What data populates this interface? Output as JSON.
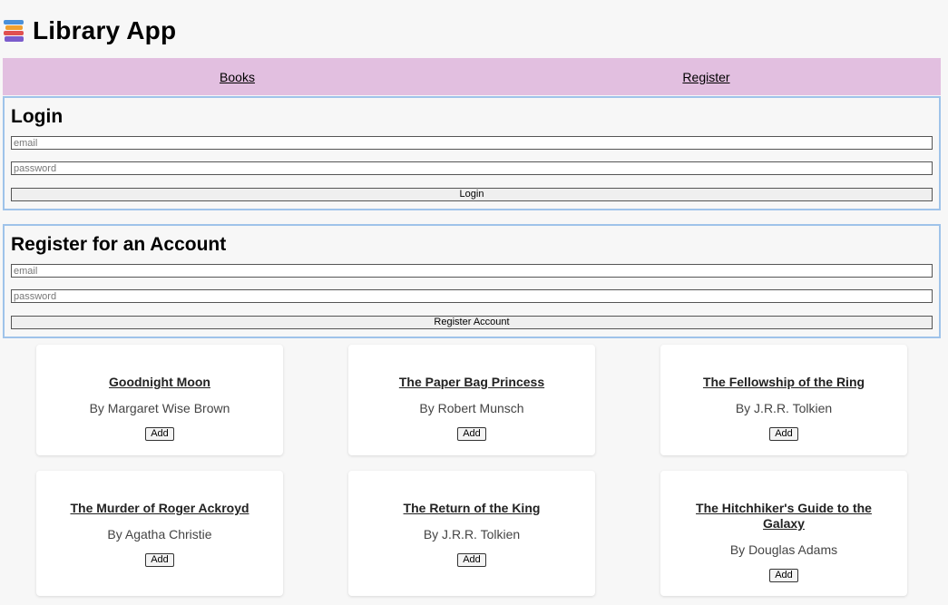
{
  "app": {
    "title": "Library App",
    "logo_icon": "books-stack-icon"
  },
  "nav": {
    "items": [
      {
        "label": "Books"
      },
      {
        "label": "Register"
      }
    ]
  },
  "login": {
    "heading": "Login",
    "email_placeholder": "email",
    "password_placeholder": "password",
    "button_label": "Login"
  },
  "register": {
    "heading": "Register for an Account",
    "email_placeholder": "email",
    "password_placeholder": "password",
    "button_label": "Register Account"
  },
  "books": [
    {
      "title": "Goodnight Moon",
      "author": "By Margaret Wise Brown",
      "add_label": "Add"
    },
    {
      "title": "The Paper Bag Princess",
      "author": "By Robert Munsch",
      "add_label": "Add"
    },
    {
      "title": "The Fellowship of the Ring",
      "author": "By J.R.R. Tolkien",
      "add_label": "Add"
    },
    {
      "title": "The Murder of Roger Ackroyd",
      "author": "By Agatha Christie",
      "add_label": "Add"
    },
    {
      "title": "The Return of the King",
      "author": "By J.R.R. Tolkien",
      "add_label": "Add"
    },
    {
      "title": "The Hitchhiker's Guide to the Galaxy",
      "author": "By Douglas Adams",
      "add_label": "Add"
    }
  ],
  "colors": {
    "nav_background": "#e2bfe0",
    "form_border": "#9fc3ea",
    "page_background": "#f7f7f7"
  }
}
